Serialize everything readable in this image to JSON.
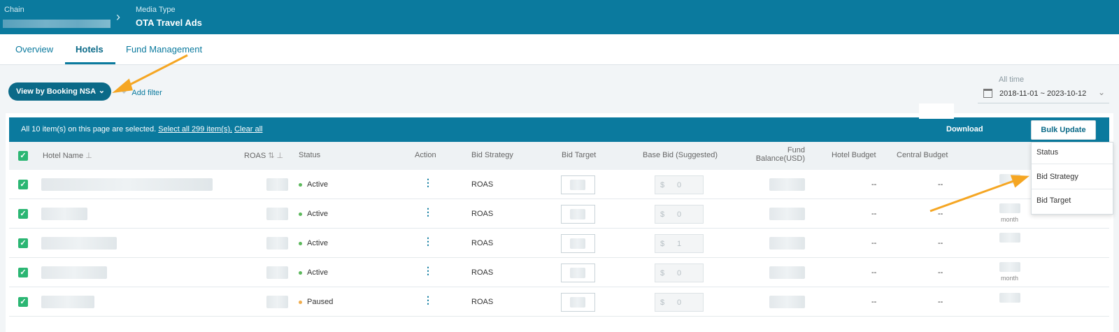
{
  "header": {
    "chain_label": "Chain",
    "separator": "›",
    "media_type_label": "Media Type",
    "media_type_value": "OTA Travel Ads"
  },
  "tabs": [
    "Overview",
    "Hotels",
    "Fund Management"
  ],
  "toolbar": {
    "view_button": "View by Booking NSA",
    "view_chevron": "⌄",
    "add_filter": "Add filter",
    "date_label": "All time",
    "date_range": "2018-11-01 ~ 2023-10-12",
    "date_chevron": "⌄"
  },
  "selection_bar": {
    "message": "All 10 item(s) on this page are selected.",
    "select_all": "Select all 299 item(s).",
    "clear_all": "Clear all",
    "download": "Download",
    "bulk_update": "Bulk Update"
  },
  "table": {
    "columns": {
      "hotel_name": "Hotel Name",
      "roas": "ROAS",
      "status": "Status",
      "action": "Action",
      "bid_strategy": "Bid Strategy",
      "bid_target": "Bid Target",
      "base_bid": "Base Bid (Suggested)",
      "fund_balance": "Fund Balance(USD)",
      "hotel_budget": "Hotel Budget",
      "central_budget": "Central Budget"
    },
    "rows": [
      {
        "status": "Active",
        "status_color": "#5cb85c",
        "bid_strategy": "ROAS",
        "currency": "$",
        "base_bid": "0",
        "hotel_budget": "--",
        "central_budget": "--",
        "budget_unit": ""
      },
      {
        "status": "Active",
        "status_color": "#5cb85c",
        "bid_strategy": "ROAS",
        "currency": "$",
        "base_bid": "0",
        "hotel_budget": "--",
        "central_budget": "--",
        "budget_unit": "month"
      },
      {
        "status": "Active",
        "status_color": "#5cb85c",
        "bid_strategy": "ROAS",
        "currency": "$",
        "base_bid": "1",
        "hotel_budget": "--",
        "central_budget": "--",
        "budget_unit": ""
      },
      {
        "status": "Active",
        "status_color": "#5cb85c",
        "bid_strategy": "ROAS",
        "currency": "$",
        "base_bid": "0",
        "hotel_budget": "--",
        "central_budget": "--",
        "budget_unit": "month"
      },
      {
        "status": "Paused",
        "status_color": "#f0ad4e",
        "bid_strategy": "ROAS",
        "currency": "$",
        "base_bid": "0",
        "hotel_budget": "--",
        "central_budget": "--",
        "budget_unit": ""
      }
    ]
  },
  "bulk_menu": [
    "Status",
    "Bid Strategy",
    "Bid Target"
  ],
  "colors": {
    "primary": "#0b7a9e",
    "check": "#2bb673",
    "annotation_arrow": "#f5a623"
  },
  "icons": {
    "check": "✓",
    "kebab": "⋮",
    "pin": "📌",
    "sort": "⇅"
  }
}
